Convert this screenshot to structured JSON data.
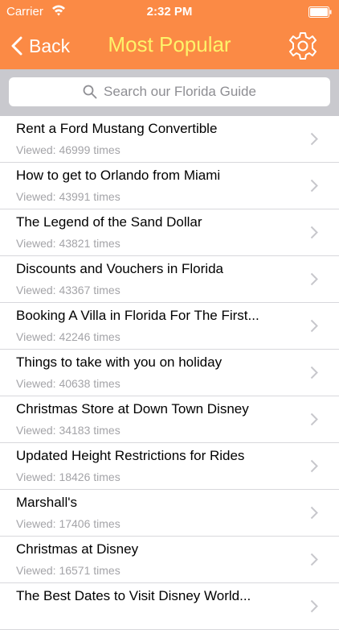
{
  "status": {
    "carrier": "Carrier",
    "time": "2:32 PM"
  },
  "nav": {
    "back_label": "Back",
    "title": "Most Popular"
  },
  "search": {
    "placeholder": "Search our Florida Guide"
  },
  "items": [
    {
      "title": "Rent a Ford Mustang Convertible",
      "views": "Viewed: 46999 times"
    },
    {
      "title": "How to get to Orlando from Miami",
      "views": "Viewed: 43991 times"
    },
    {
      "title": "The Legend of the Sand Dollar",
      "views": "Viewed: 43821 times"
    },
    {
      "title": "Discounts and Vouchers in Florida",
      "views": "Viewed: 43367 times"
    },
    {
      "title": "Booking A Villa in Florida For The First...",
      "views": "Viewed: 42246 times"
    },
    {
      "title": "Things to take with you on holiday",
      "views": "Viewed: 40638 times"
    },
    {
      "title": "Christmas Store at Down Town Disney",
      "views": "Viewed: 34183 times"
    },
    {
      "title": "Updated Height Restrictions for Rides",
      "views": "Viewed: 18426 times"
    },
    {
      "title": "Marshall's",
      "views": "Viewed: 17406 times"
    },
    {
      "title": "Christmas at Disney",
      "views": "Viewed: 16571 times"
    },
    {
      "title": "The Best Dates to Visit Disney World...",
      "views": ""
    }
  ],
  "colors": {
    "header": "#fb8a45",
    "title": "#fdf36a"
  }
}
